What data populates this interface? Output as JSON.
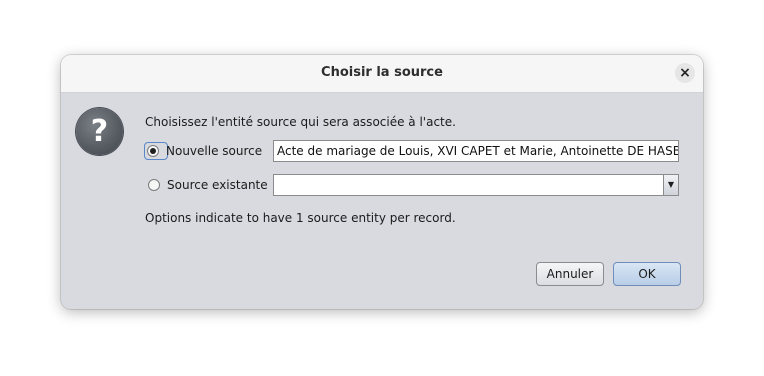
{
  "dialog": {
    "title": "Choisir la source",
    "close_label": "×"
  },
  "content": {
    "icon": "question-icon",
    "prompt": "Choisissez l'entité source qui sera associée à l'acte.",
    "new_source": {
      "label": "Nouvelle source",
      "selected": true,
      "value": "Acte de mariage de Louis, XVI CAPET et Marie, Antoinette DE HASBOUR"
    },
    "existing_source": {
      "label": "Source existante",
      "selected": false,
      "value": ""
    },
    "info": "Options indicate to have 1 source entity per record."
  },
  "buttons": {
    "cancel": "Annuler",
    "ok": "OK"
  },
  "colors": {
    "dialog_background": "#d8dae0",
    "titlebar_background": "#f6f6f6",
    "default_button": "#c4d6ec"
  }
}
